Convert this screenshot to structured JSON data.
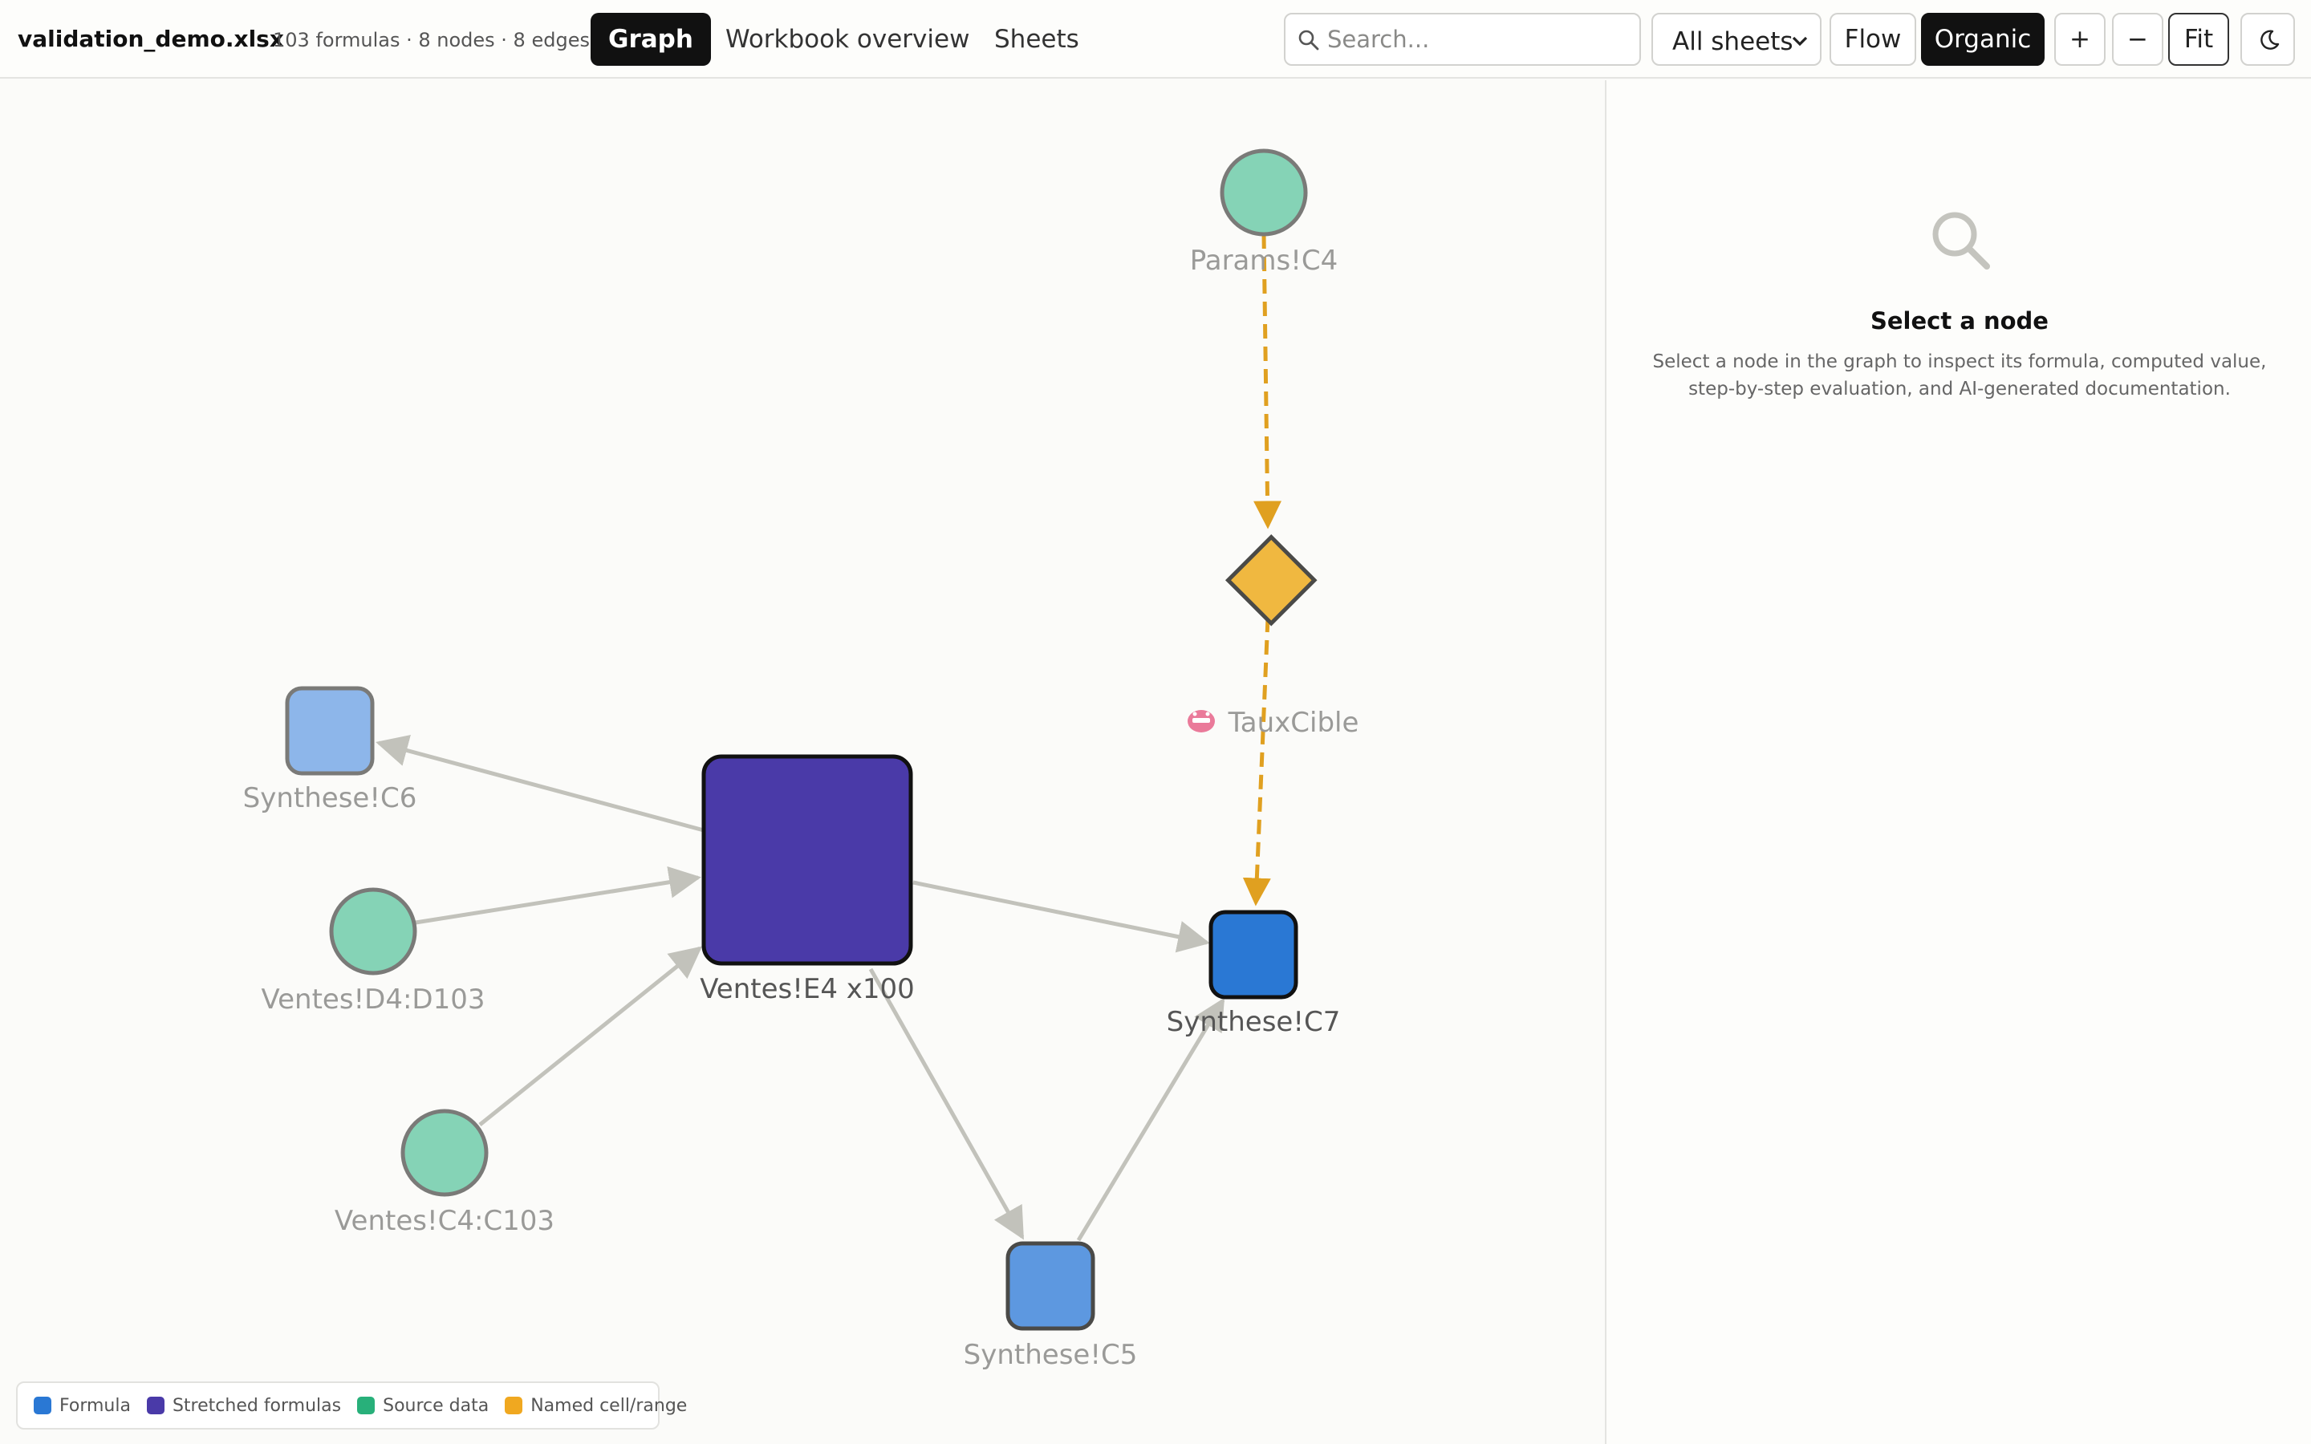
{
  "header": {
    "file_name": "validation_demo.xlsx",
    "stats": "103 formulas · 8 nodes · 8 edges",
    "tabs": [
      {
        "label": "Graph",
        "active": true
      },
      {
        "label": "Workbook overview",
        "active": false
      },
      {
        "label": "Sheets",
        "active": false
      }
    ],
    "search_placeholder": "Search...",
    "sheet_filter": "All sheets",
    "layout_flow": "Flow",
    "layout_organic": "Organic",
    "zoom_in": "+",
    "zoom_out": "−",
    "fit": "Fit"
  },
  "graph": {
    "nodes": [
      {
        "id": "params_c4",
        "label": "Params!C4",
        "kind": "source",
        "shape": "circle"
      },
      {
        "id": "tauxcible",
        "label": "TauxCible",
        "kind": "named",
        "shape": "diamond",
        "badge_icon": "mask-icon"
      },
      {
        "id": "synthese_c6",
        "label": "Synthese!C6",
        "kind": "formula",
        "shape": "rounded-square"
      },
      {
        "id": "ventes_e4",
        "label": "Ventes!E4 x100",
        "kind": "stretched",
        "shape": "rounded-square"
      },
      {
        "id": "ventes_d4",
        "label": "Ventes!D4:D103",
        "kind": "source",
        "shape": "circle"
      },
      {
        "id": "ventes_c4",
        "label": "Ventes!C4:C103",
        "kind": "source",
        "shape": "circle"
      },
      {
        "id": "synthese_c7",
        "label": "Synthese!C7",
        "kind": "formula",
        "shape": "rounded-square"
      },
      {
        "id": "synthese_c5",
        "label": "Synthese!C5",
        "kind": "formula",
        "shape": "rounded-square"
      }
    ],
    "edges": [
      {
        "from": "params_c4",
        "to": "tauxcible",
        "style": "dashed"
      },
      {
        "from": "tauxcible",
        "to": "synthese_c7",
        "style": "dashed"
      },
      {
        "from": "ventes_e4",
        "to": "synthese_c6",
        "style": "solid"
      },
      {
        "from": "ventes_d4",
        "to": "ventes_e4",
        "style": "solid"
      },
      {
        "from": "ventes_c4",
        "to": "ventes_e4",
        "style": "solid"
      },
      {
        "from": "ventes_e4",
        "to": "synthese_c7",
        "style": "solid"
      },
      {
        "from": "ventes_e4",
        "to": "synthese_c5",
        "style": "solid"
      },
      {
        "from": "synthese_c5",
        "to": "synthese_c7",
        "style": "solid"
      }
    ]
  },
  "legend": [
    {
      "label": "Formula",
      "color": "#2a78d4"
    },
    {
      "label": "Stretched formulas",
      "color": "#4a3aa8"
    },
    {
      "label": "Source data",
      "color": "#28b07a"
    },
    {
      "label": "Named cell/range",
      "color": "#f0a820"
    }
  ],
  "panel": {
    "title": "Select a node",
    "description": "Select a node in the graph to inspect its formula, computed value, step-by-step evaluation, and AI-generated documentation."
  },
  "colors": {
    "accent": "#111111",
    "edge": "#c2c2bb",
    "named_edge": "#e0a020",
    "formula": "#2a78d4",
    "formula_light": "#8db6ea",
    "formula_mid": "#5d98e0",
    "stretched": "#4a3aa8",
    "source": "#85d3b6",
    "named": "#f0b840"
  }
}
